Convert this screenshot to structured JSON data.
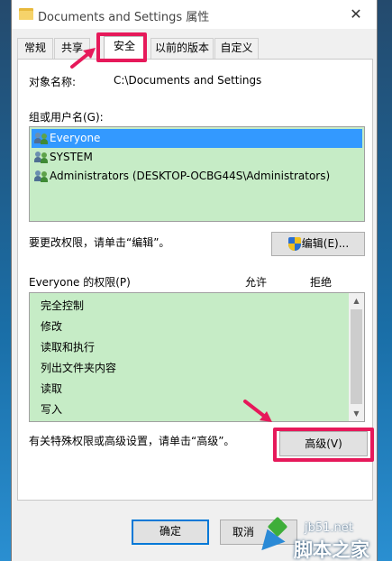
{
  "window": {
    "title": "Documents and Settings 属性",
    "close_glyph": "✕"
  },
  "tabs": [
    {
      "label": "常规",
      "active": false
    },
    {
      "label": "共享",
      "active": false
    },
    {
      "label": "安全",
      "active": true
    },
    {
      "label": "以前的版本",
      "active": false
    },
    {
      "label": "自定义",
      "active": false
    }
  ],
  "security": {
    "object_label": "对象名称:",
    "object_value": "C:\\Documents and Settings",
    "groups_label": "组或用户名(G):",
    "groups": [
      {
        "name": "Everyone",
        "selected": true,
        "icon": "users-icon"
      },
      {
        "name": "SYSTEM",
        "selected": false,
        "icon": "users-icon"
      },
      {
        "name": "Administrators (DESKTOP-OCBG44S\\Administrators)",
        "selected": false,
        "icon": "users-icon"
      }
    ],
    "change_hint": "要更改权限，请单击“编辑”。",
    "edit_button": "编辑(E)...",
    "permissions_title": "Everyone 的权限(P)",
    "allow_header": "允许",
    "deny_header": "拒绝",
    "permissions": [
      "完全控制",
      "修改",
      "读取和执行",
      "列出文件夹内容",
      "读取",
      "写入"
    ],
    "special_hint": "有关特殊权限或高级设置，请单击“高级”。",
    "advanced_button": "高级(V)"
  },
  "footer": {
    "ok_button": "确定",
    "cancel_button": "取消"
  },
  "watermark": {
    "url": "jb51.net",
    "name": "脚本之家"
  },
  "colors": {
    "highlight": "#e6195a",
    "selection": "#3399ff",
    "list_background": "#c6ecc6"
  }
}
